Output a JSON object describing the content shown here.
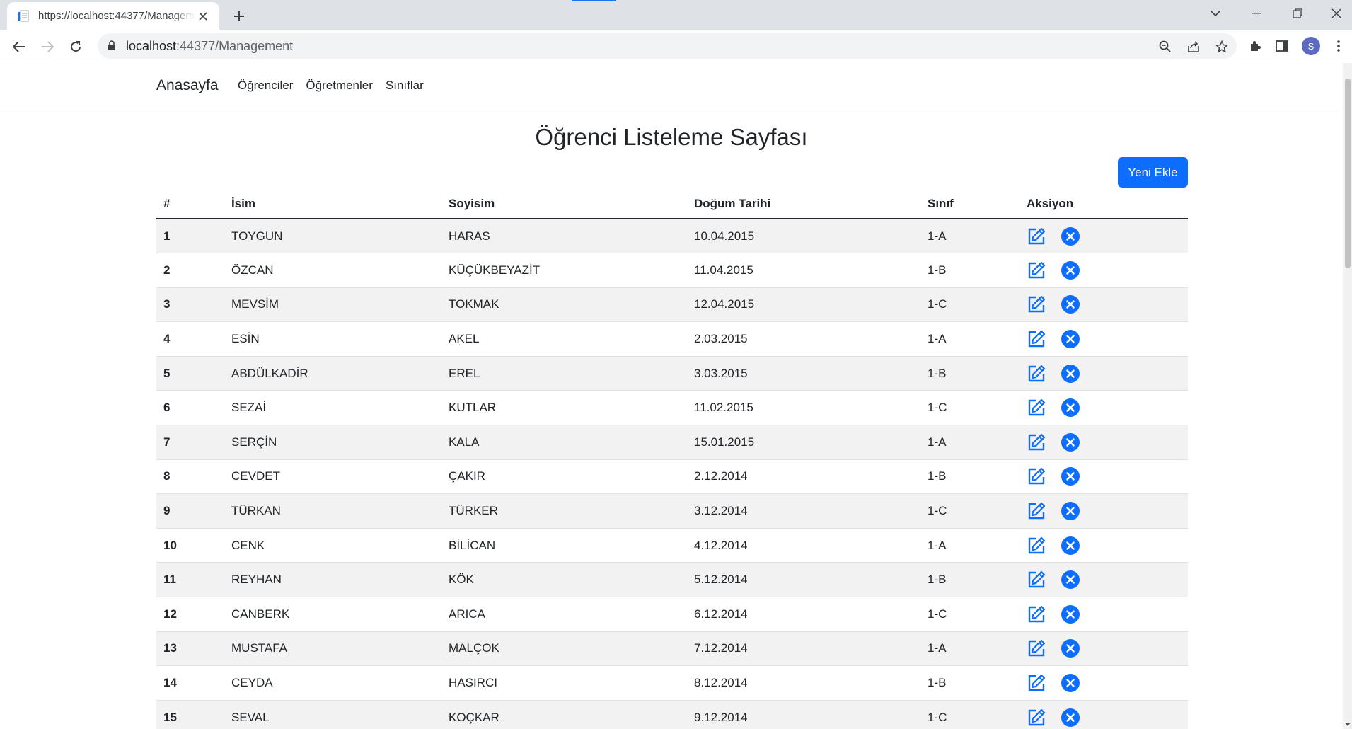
{
  "browser": {
    "tab_title": "https://localhost:44377/Management",
    "url_host": "localhost",
    "url_rest": ":44377/Management",
    "avatar_letter": "S"
  },
  "navbar": {
    "brand": "Anasayfa",
    "links": [
      "Öğrenciler",
      "Öğretmenler",
      "Sınıflar"
    ]
  },
  "page": {
    "title": "Öğrenci Listeleme Sayfası",
    "new_button": "Yeni Ekle"
  },
  "table": {
    "headers": [
      "#",
      "İsim",
      "Soyisim",
      "Doğum Tarihi",
      "Sınıf",
      "Aksiyon"
    ],
    "rows": [
      [
        "1",
        "TOYGUN",
        "HARAS",
        "10.04.2015",
        "1-A"
      ],
      [
        "2",
        "ÖZCAN",
        "KÜÇÜKBEYAZİT",
        "11.04.2015",
        "1-B"
      ],
      [
        "3",
        "MEVSİM",
        "TOKMAK",
        "12.04.2015",
        "1-C"
      ],
      [
        "4",
        "ESİN",
        "AKEL",
        "2.03.2015",
        "1-A"
      ],
      [
        "5",
        "ABDÜLKADİR",
        "EREL",
        "3.03.2015",
        "1-B"
      ],
      [
        "6",
        "SEZAİ",
        "KUTLAR",
        "11.02.2015",
        "1-C"
      ],
      [
        "7",
        "SERÇİN",
        "KALA",
        "15.01.2015",
        "1-A"
      ],
      [
        "8",
        "CEVDET",
        "ÇAKIR",
        "2.12.2014",
        "1-B"
      ],
      [
        "9",
        "TÜRKAN",
        "TÜRKER",
        "3.12.2014",
        "1-C"
      ],
      [
        "10",
        "CENK",
        "BİLİCAN",
        "4.12.2014",
        "1-A"
      ],
      [
        "11",
        "REYHAN",
        "KÖK",
        "5.12.2014",
        "1-B"
      ],
      [
        "12",
        "CANBERK",
        "ARICA",
        "6.12.2014",
        "1-C"
      ],
      [
        "13",
        "MUSTAFA",
        "MALÇOK",
        "7.12.2014",
        "1-A"
      ],
      [
        "14",
        "CEYDA",
        "HASIRCI",
        "8.12.2014",
        "1-B"
      ],
      [
        "15",
        "SEVAL",
        "KOÇKAR",
        "9.12.2014",
        "1-C"
      ]
    ]
  },
  "colors": {
    "primary": "#0d6efd",
    "icon_blue": "#0d6efd"
  }
}
